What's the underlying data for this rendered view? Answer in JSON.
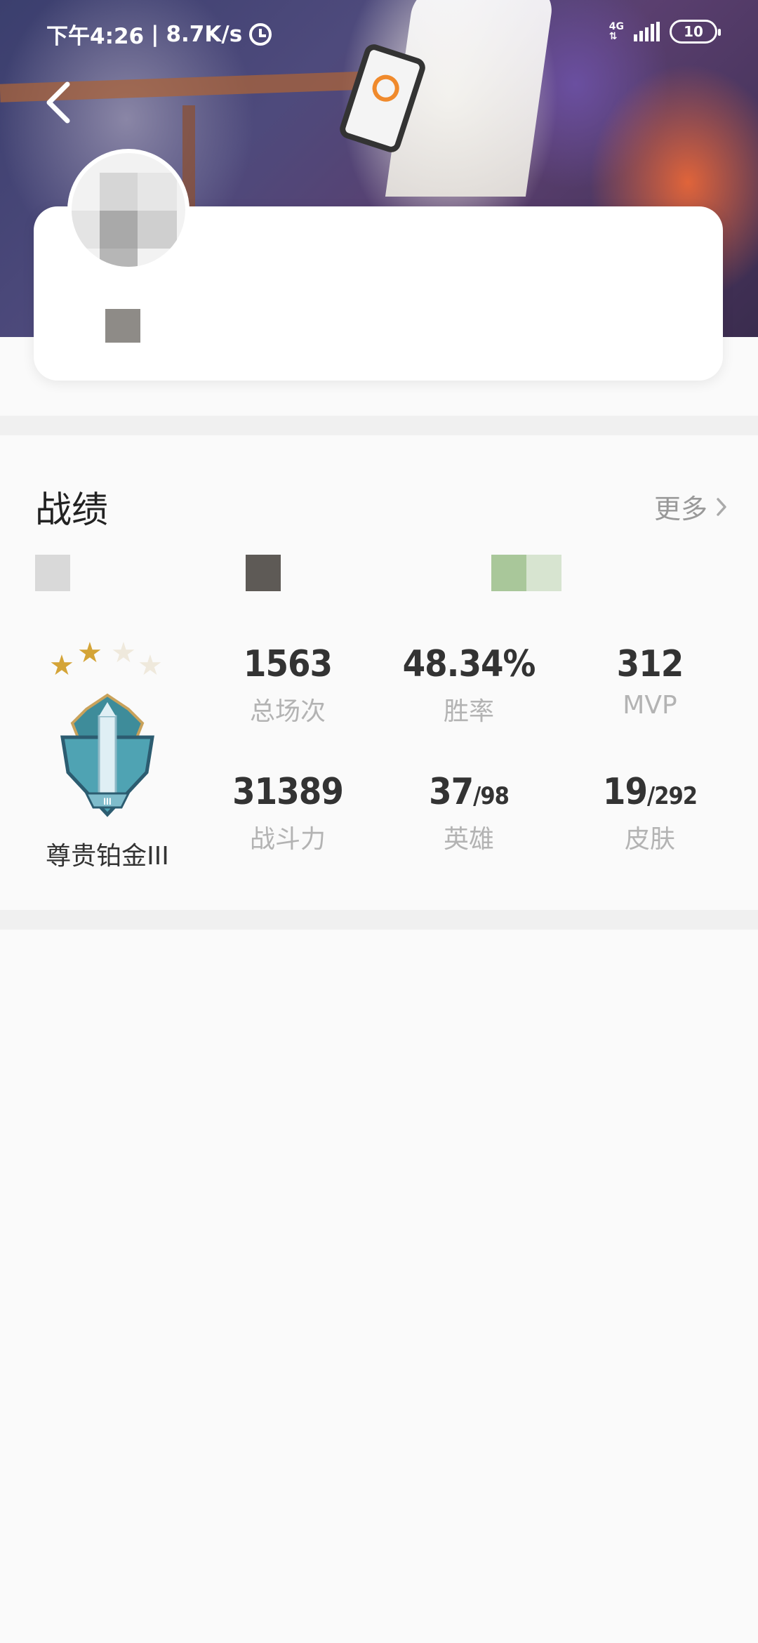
{
  "status_bar": {
    "time": "下午4:26",
    "speed": "8.7K/s",
    "network": "4G",
    "battery": "10",
    "icons": [
      "alarm-icon",
      "signal-icon",
      "battery-icon"
    ]
  },
  "header": {
    "back_icon": "chevron-left-icon"
  },
  "record": {
    "title": "战绩",
    "more_label": "更多",
    "rank": {
      "name": "尊贵铂金III",
      "stars_filled": 2,
      "stars_total": 4
    },
    "stats": [
      {
        "value": "1563",
        "sub": "",
        "label": "总场次"
      },
      {
        "value": "48.34%",
        "sub": "",
        "label": "胜率"
      },
      {
        "value": "312",
        "sub": "",
        "label": "MVP"
      },
      {
        "value": "31389",
        "sub": "",
        "label": "战斗力"
      },
      {
        "value": "37",
        "sub": "/98",
        "label": "英雄"
      },
      {
        "value": "19",
        "sub": "/292",
        "label": "皮肤"
      }
    ]
  },
  "colors": {
    "background": "#fafafa",
    "card": "#ffffff",
    "text_primary": "#333333",
    "text_secondary": "#b3b3b3",
    "star_gold": "#d4a437",
    "star_empty": "#efe9dc"
  }
}
